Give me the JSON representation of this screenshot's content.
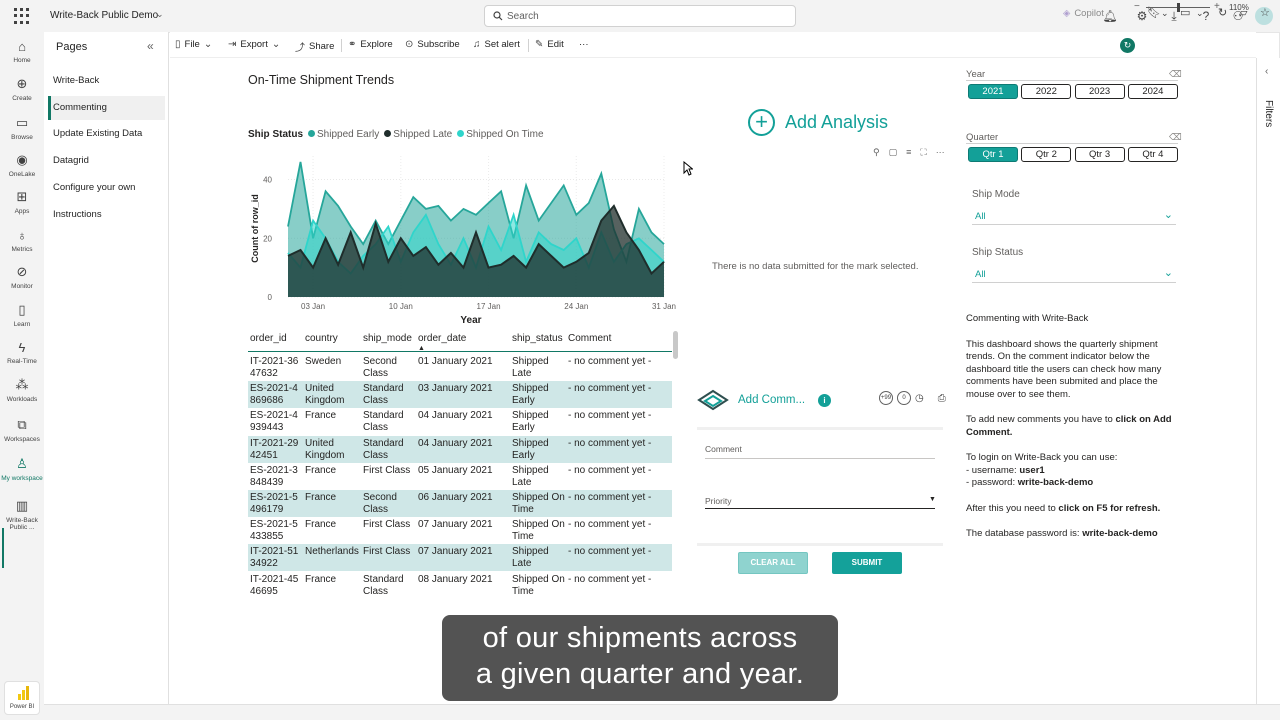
{
  "app": {
    "workspace_title": "Write-Back Public Demo",
    "search_placeholder": "Search"
  },
  "leftnav": [
    {
      "icon": "home-icon",
      "glyph": "⌂",
      "label": "Home"
    },
    {
      "icon": "create-icon",
      "glyph": "⊕",
      "label": "Create"
    },
    {
      "icon": "browse-icon",
      "glyph": "▭",
      "label": "Browse"
    },
    {
      "icon": "onelake-icon",
      "glyph": "◉",
      "label": "OneLake"
    },
    {
      "icon": "apps-icon",
      "glyph": "⊞",
      "label": "Apps"
    },
    {
      "icon": "metrics-icon",
      "glyph": "♁",
      "label": "Metrics"
    },
    {
      "icon": "monitor-icon",
      "glyph": "⊘",
      "label": "Monitor"
    },
    {
      "icon": "learn-icon",
      "glyph": "▯",
      "label": "Learn"
    },
    {
      "icon": "realtime-icon",
      "glyph": "ϟ",
      "label": "Real-Time"
    },
    {
      "icon": "workloads-icon",
      "glyph": "⁂",
      "label": "Workloads"
    },
    {
      "icon": "workspaces-icon",
      "glyph": "⧉",
      "label": "Workspaces"
    },
    {
      "icon": "my-workspace-icon",
      "glyph": "♙",
      "label": "My workspace"
    },
    {
      "icon": "report-icon",
      "glyph": "▥",
      "label": "Write-Back Public ..."
    }
  ],
  "powerbi_label": "Power BI",
  "pages": {
    "title": "Pages",
    "items": [
      "Write-Back",
      "Commenting",
      "Update Existing Data",
      "Datagrid",
      "Configure your own",
      "Instructions"
    ],
    "active_index": 1
  },
  "toolbar": {
    "file": "File",
    "export": "Export",
    "share": "Share",
    "explore": "Explore",
    "subscribe": "Subscribe",
    "set_alert": "Set alert",
    "edit": "Edit",
    "more": "···",
    "copilot": "Copilot"
  },
  "report": {
    "title": "On-Time Shipment Trends",
    "legend_title": "Ship Status",
    "legend": [
      {
        "name": "Shipped Early",
        "color": "#26a69a"
      },
      {
        "name": "Shipped Late",
        "color": "#1f2d2b"
      },
      {
        "name": "Shipped On Time",
        "color": "#2fd5cb"
      }
    ]
  },
  "chart_data": {
    "type": "area",
    "xlabel": "Year",
    "ylabel": "Count of row_id",
    "x_ticks": [
      "03 Jan",
      "10 Jan",
      "17 Jan",
      "24 Jan",
      "31 Jan"
    ],
    "y_ticks": [
      "0",
      "20",
      "40"
    ],
    "ylim": [
      0,
      48
    ],
    "x": [
      1,
      2,
      3,
      4,
      5,
      6,
      7,
      8,
      9,
      10,
      11,
      12,
      13,
      14,
      15,
      16,
      17,
      18,
      19,
      20,
      21,
      22,
      23,
      24,
      25,
      26,
      27,
      28,
      29,
      30,
      31
    ],
    "series": [
      {
        "name": "Shipped Early",
        "color": "#26a69a",
        "values": [
          24,
          46,
          20,
          36,
          31,
          24,
          18,
          26,
          18,
          26,
          34,
          30,
          31,
          26,
          30,
          28,
          32,
          36,
          20,
          38,
          26,
          32,
          38,
          28,
          32,
          42,
          23,
          12,
          30,
          22,
          18
        ]
      },
      {
        "name": "Shipped Late",
        "color": "#1f2d2b",
        "values": [
          14,
          16,
          10,
          20,
          11,
          22,
          10,
          25,
          12,
          20,
          14,
          17,
          11,
          15,
          10,
          22,
          10,
          11,
          14,
          10,
          18,
          14,
          10,
          12,
          15,
          26,
          31,
          22,
          16,
          8,
          12
        ]
      },
      {
        "name": "Shipped On Time",
        "color": "#2fd5cb",
        "values": [
          15,
          10,
          26,
          20,
          12,
          8,
          14,
          18,
          24,
          12,
          22,
          28,
          18,
          11,
          20,
          10,
          24,
          16,
          28,
          12,
          22,
          18,
          16,
          20,
          10,
          22,
          12,
          18,
          20,
          16,
          12
        ]
      }
    ]
  },
  "table": {
    "columns": [
      "order_id",
      "country",
      "ship_mode",
      "order_date",
      "ship_status",
      "Comment"
    ],
    "rows": [
      [
        "IT-2021-3647632",
        "Sweden",
        "Second Class",
        "01 January 2021",
        "Shipped Late",
        "- no comment yet -"
      ],
      [
        "ES-2021-4869686",
        "United Kingdom",
        "Standard Class",
        "03 January 2021",
        "Shipped Early",
        "- no comment yet -"
      ],
      [
        "ES-2021-4939443",
        "France",
        "Standard Class",
        "04 January 2021",
        "Shipped Early",
        "- no comment yet -"
      ],
      [
        "IT-2021-2942451",
        "United Kingdom",
        "Standard Class",
        "04 January 2021",
        "Shipped Early",
        "- no comment yet -"
      ],
      [
        "ES-2021-3848439",
        "France",
        "First Class",
        "05 January 2021",
        "Shipped Late",
        "- no comment yet -"
      ],
      [
        "ES-2021-5496179",
        "France",
        "Second Class",
        "06 January 2021",
        "Shipped On Time",
        "- no comment yet -"
      ],
      [
        "ES-2021-5433855",
        "France",
        "First Class",
        "07 January 2021",
        "Shipped On Time",
        "- no comment yet -"
      ],
      [
        "IT-2021-5134922",
        "Netherlands",
        "First Class",
        "07 January 2021",
        "Shipped Late",
        "- no comment yet -"
      ],
      [
        "IT-2021-4546695",
        "France",
        "Standard Class",
        "08 January 2021",
        "Shipped On Time",
        "- no comment yet -"
      ]
    ]
  },
  "analysis": {
    "add_label": "Add Analysis",
    "no_data": "There is no data submitted for the mark selected."
  },
  "comment_panel": {
    "title": "Add Comm...",
    "badge1": "+99",
    "badge2": "0",
    "comment_placeholder": "Comment",
    "priority_placeholder": "Priority",
    "clear_all": "CLEAR ALL",
    "submit": "SUBMIT"
  },
  "slicers": {
    "year_title": "Year",
    "years": [
      "2021",
      "2022",
      "2023",
      "2024"
    ],
    "year_selected": "2021",
    "quarter_title": "Quarter",
    "quarters": [
      "Qtr 1",
      "Qtr 2",
      "Qtr 3",
      "Qtr 4"
    ],
    "quarter_selected": "Qtr 1",
    "ship_mode_label": "Ship Mode",
    "ship_mode_value": "All",
    "ship_status_label": "Ship Status",
    "ship_status_value": "All"
  },
  "info": {
    "heading": "Commenting with Write-Back",
    "para1": "This dashboard shows the quarterly shipment trends. On the comment indicator below the dashboard title the users can check how many comments have been submited and place the mouse over to see them.",
    "para2_prefix": "To add new comments you have to ",
    "para2_bold": "click on Add Comment.",
    "para3": "To login on Write-Back you can use:",
    "username_prefix": "- username: ",
    "username": "user1",
    "password_prefix": "- password: ",
    "password": "write-back-demo",
    "para4_prefix": "After this you need to ",
    "para4_bold": "click on F5 for refresh.",
    "para5_prefix": "The database password is: ",
    "para5_bold": "write-back-demo"
  },
  "filters_label": "Filters",
  "zoom": "110%",
  "caption": {
    "line1": "of our shipments across",
    "line2": "a given quarter and year."
  }
}
